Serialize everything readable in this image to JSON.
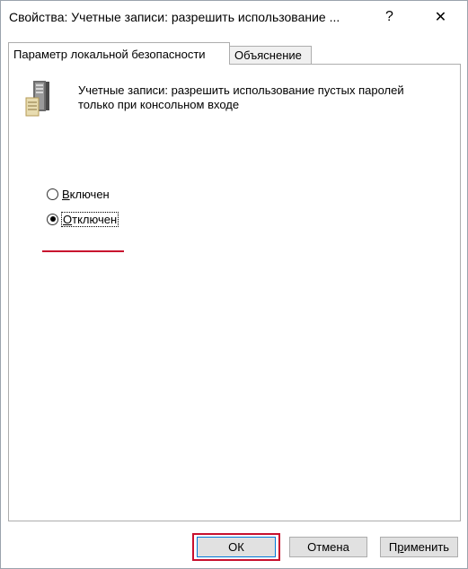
{
  "window": {
    "title": "Свойства: Учетные записи: разрешить использование ...",
    "help_label": "?",
    "close_label": "✕"
  },
  "tabs": [
    {
      "label": "Параметр локальной безопасности",
      "active": true
    },
    {
      "label": "Объяснение",
      "active": false
    }
  ],
  "policy": {
    "icon": "server-policy-icon",
    "text_line1": "Учетные записи: разрешить использование пустых паролей",
    "text_line2": "только при консольном входе"
  },
  "options": {
    "enabled": {
      "label_access": "В",
      "label_rest": "ключен",
      "checked": false
    },
    "disabled": {
      "label_access": "О",
      "label_rest": "тключен",
      "checked": true
    }
  },
  "buttons": {
    "ok": "ОК",
    "cancel": "Отмена",
    "apply_access": "р",
    "apply_prefix": "П",
    "apply_rest": "именить"
  },
  "colors": {
    "highlight": "#c8102e",
    "default_button_border": "#0078d7"
  }
}
